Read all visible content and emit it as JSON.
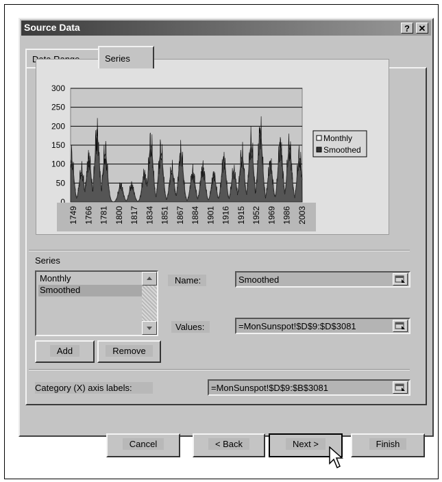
{
  "window": {
    "title": "Source Data",
    "help_glyph": "?",
    "close_glyph": "✕"
  },
  "tabs": [
    {
      "label": "Data Range",
      "active": false
    },
    {
      "label": "Series",
      "active": true
    }
  ],
  "chart_data": {
    "type": "area",
    "y_ticks": [
      "0",
      "50",
      "100",
      "150",
      "200",
      "250",
      "300"
    ],
    "ylim": [
      0,
      300
    ],
    "x_ticks": [
      "1749",
      "1766",
      "1781",
      "1800",
      "1817",
      "1834",
      "1851",
      "1867",
      "1884",
      "1901",
      "1916",
      "1915",
      "1952",
      "1969",
      "1986",
      "2003"
    ],
    "legend_position": "right",
    "series": [
      {
        "name": "Monthly",
        "color": "#555555"
      },
      {
        "name": "Smoothed",
        "color": "#333333"
      }
    ],
    "cycle_peaks": [
      {
        "year": 1750,
        "value": 155
      },
      {
        "year": 1761,
        "value": 110
      },
      {
        "year": 1769,
        "value": 155
      },
      {
        "year": 1778,
        "value": 240
      },
      {
        "year": 1787,
        "value": 175
      },
      {
        "year": 1804,
        "value": 60
      },
      {
        "year": 1816,
        "value": 60
      },
      {
        "year": 1830,
        "value": 100
      },
      {
        "year": 1837,
        "value": 205
      },
      {
        "year": 1848,
        "value": 180
      },
      {
        "year": 1860,
        "value": 115
      },
      {
        "year": 1870,
        "value": 175
      },
      {
        "year": 1883,
        "value": 105
      },
      {
        "year": 1894,
        "value": 120
      },
      {
        "year": 1906,
        "value": 95
      },
      {
        "year": 1917,
        "value": 150
      },
      {
        "year": 1928,
        "value": 110
      },
      {
        "year": 1937,
        "value": 165
      },
      {
        "year": 1947,
        "value": 205
      },
      {
        "year": 1957,
        "value": 250
      },
      {
        "year": 1968,
        "value": 135
      },
      {
        "year": 1979,
        "value": 200
      },
      {
        "year": 1989,
        "value": 195
      },
      {
        "year": 2000,
        "value": 160
      }
    ]
  },
  "series_section": {
    "label": "Series",
    "items": [
      "Monthly",
      "Smoothed"
    ],
    "selected_index": 1,
    "add_label": "Add",
    "remove_label": "Remove"
  },
  "name_field": {
    "label": "Name:",
    "value": "Smoothed"
  },
  "values_field": {
    "label": "Values:",
    "value": "=MonSunspot!$D$9:$D$3081"
  },
  "category_field": {
    "label": "Category (X) axis labels:",
    "value": "=MonSunspot!$D$9:$B$3081"
  },
  "footer": {
    "cancel_label": "Cancel",
    "back_label": "< Back",
    "next_label": "Next >",
    "finish_label": "Finish"
  }
}
